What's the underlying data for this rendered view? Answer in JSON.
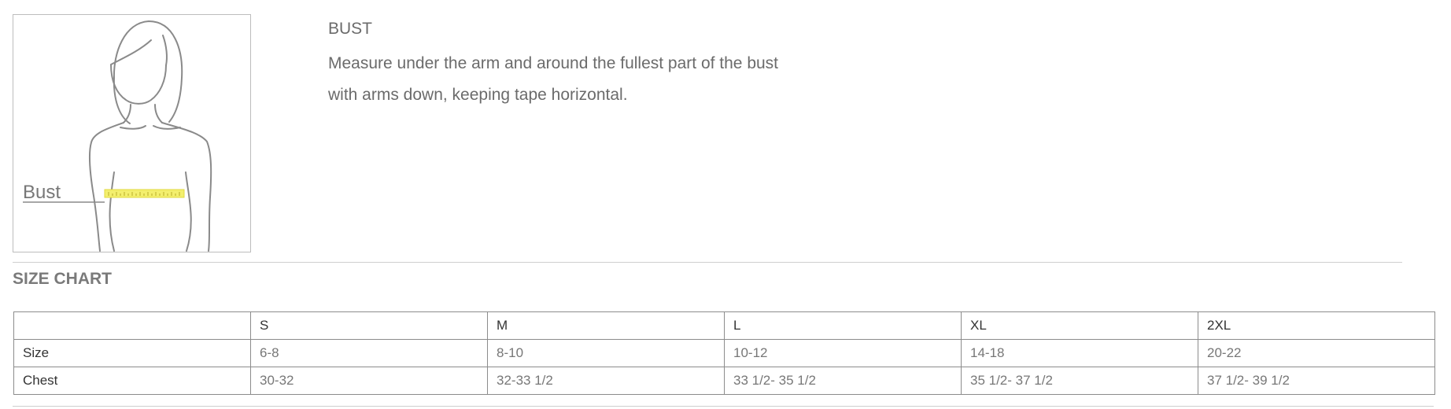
{
  "figure": {
    "label": "Bust",
    "tape_color": "#f3ef6e"
  },
  "measure": {
    "title": "BUST",
    "description_line1": "Measure under the arm and around the fullest part of the bust",
    "description_line2": "with arms down, keeping tape horizontal."
  },
  "size_chart": {
    "title": "SIZE CHART",
    "columns": [
      "S",
      "M",
      "L",
      "XL",
      "2XL"
    ],
    "rows": [
      {
        "label": "Size",
        "values": [
          "6-8",
          "8-10",
          "10-12",
          "14-18",
          "20-22"
        ]
      },
      {
        "label": "Chest",
        "values": [
          "30-32",
          "32-33 1/2",
          "33 1/2- 35 1/2",
          "35 1/2- 37 1/2",
          "37 1/2- 39 1/2"
        ]
      }
    ]
  }
}
